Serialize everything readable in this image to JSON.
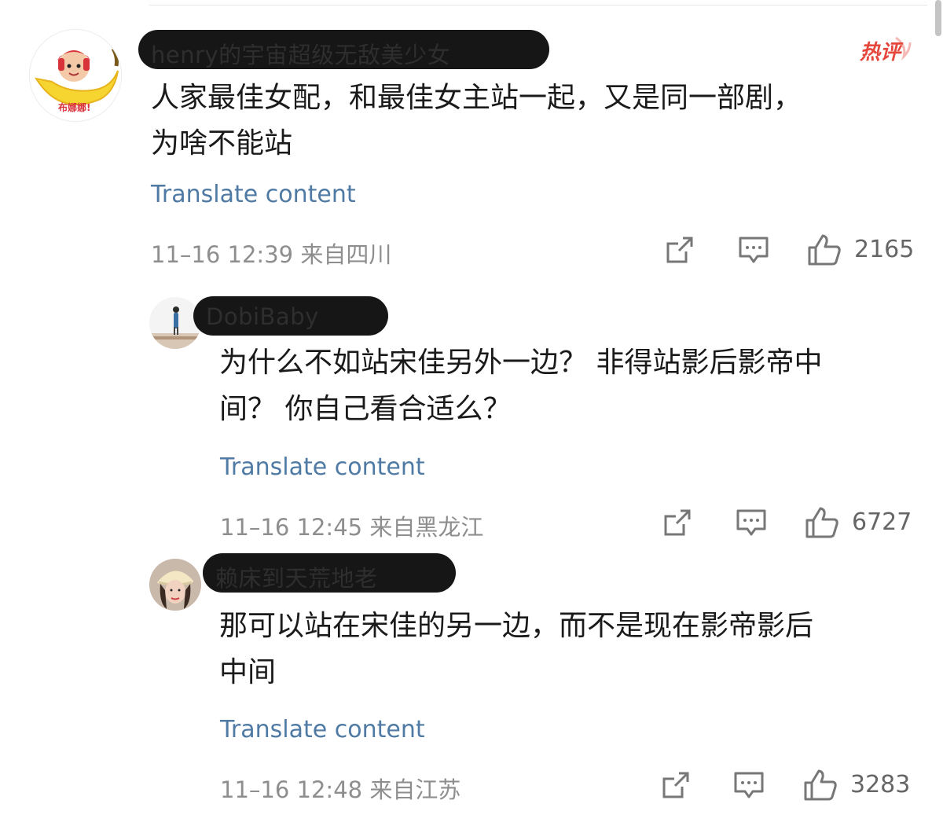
{
  "comments": [
    {
      "username": "henry的宇宙超级无敌美少女",
      "avatar_label": "布娜娜!",
      "badge": "热评",
      "text_lines": [
        "人家最佳女配，和最佳女主站一起，又是同一部剧，",
        "为啥不能站"
      ],
      "translate_label": "Translate content",
      "meta": "11–16 12:39  来自四川",
      "likes": "2165"
    },
    {
      "username": "DobiBaby",
      "text_lines": [
        "为什么不如站宋佳另外一边？ 非得站影后影帝中",
        "间？ 你自己看合适么？"
      ],
      "translate_label": "Translate content",
      "meta": "11–16 12:45  来自黑龙江",
      "likes": "6727"
    },
    {
      "username": "赖床到天荒地老",
      "text_lines": [
        "那可以站在宋佳的另一边，而不是现在影帝影后",
        "中间"
      ],
      "translate_label": "Translate content",
      "meta": "11–16 12:48  来自江苏",
      "likes": "3283"
    }
  ],
  "icons": {
    "share": "share-icon",
    "reply": "comment-icon",
    "like": "thumbs-up-icon"
  },
  "colors": {
    "link": "#4f7aa4",
    "meta": "#8e8e8e",
    "hot_badge": "#e5473d",
    "redaction": "#161616"
  }
}
